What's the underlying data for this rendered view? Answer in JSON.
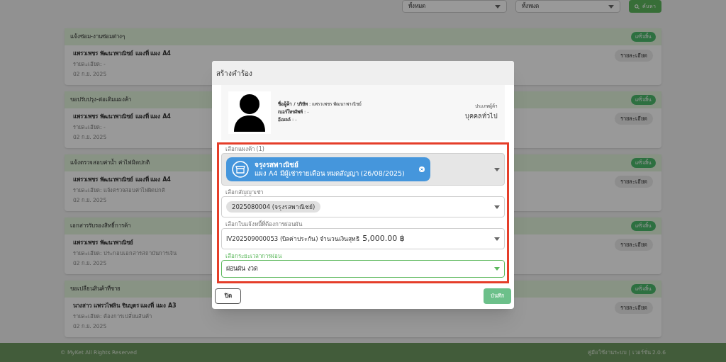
{
  "filters": [
    {
      "value": "ทั้งหมด"
    },
    {
      "value": "ทั้งหมด"
    }
  ],
  "search_button": "ค้นหา",
  "requests": [
    {
      "title": "แจ้งซ่อม-งานซ่อมต่างๆ",
      "status": "เสร็จสิ้น",
      "name": "แพรวเพชร พัฒนาพาณิชย์ แผงที่ แผง A4",
      "detail": "รายละเอียด: -",
      "date": "02 ก.ย. 2025",
      "action": "รายละเอียด"
    },
    {
      "title": "ขอปรับปรุง-ต่อเติมแผงค้า",
      "status": "เสร็จสิ้น",
      "name": "แพรวเพชร พัฒนาพาณิชย์ แผงที่ แผง A4",
      "detail": "รายละเอียด: -",
      "date": "02 ก.ย. 2025",
      "action": "รายละเอียด"
    },
    {
      "title": "แจ้งตรวจสอบค่าน้ำ ค่าไฟผิดปกติ",
      "status": "เสร็จสิ้น",
      "name": "แพรวเพชร พัฒนาพาณิชย์ แผงที่ แผง A4",
      "detail": "รายละเอียด: แจ้งตรวจสอบค่าไฟผิดปกติ",
      "date": "02 ก.ย. 2025",
      "action": "รายละเอียด"
    },
    {
      "title": "เอกสารรับรองสิทธิ์การค้า",
      "status": "เสร็จสิ้น",
      "name": "แพรวเพชร พัฒนาพาณิชย์",
      "detail": "รายละเอียด: ประกอบเอกสารสถาบันการเงิน",
      "date": "02 ก.ย. 2025",
      "action": "รายละเอียด"
    },
    {
      "title": "ขอเปลี่ยนสินค้าที่ขาย",
      "status": "เสร็จสิ้น",
      "name": "นางสาว แพรวไพลิน ชินบุตร แผงที่ แผง A3",
      "detail": "รายละเอียด: ต้องการเปลี่ยนสินค้า",
      "date": "02 ก.ย. 2025",
      "action": "รายละเอียด"
    }
  ],
  "footer": {
    "copyright": "© MyKet All Rights Reserved",
    "links": "คู่มือใช้งานระบบ | เวอร์ชั่น 2.0.6"
  },
  "modal": {
    "title": "สร้างคำร้อง",
    "customer": {
      "lines": [
        "**ชื่อผู้ค้า / บริษัท** : แพรวเพชร พัฒนาพาณิชย์",
        "**เบอร์โทรศัพท์** : -",
        "**อีเมลล์** : -"
      ],
      "type_label": "ประเภทผู้ค้า",
      "type": "บุคคลทั่วไป"
    },
    "fields": [
      {
        "kind": "shop",
        "label": "เลือกแผงค้า (1)",
        "chip_title": "จรุงรสพาณิชย์",
        "chip_subtitle": "แผง A4 มีผู้เช่ารายเดือน หมดสัญญา (26/08/2025)",
        "focused": false
      },
      {
        "kind": "chip",
        "label": "เลือกสัญญาเช่า",
        "value": "2025080004 (จรุงรสพาณิชย์)",
        "focused": false
      },
      {
        "kind": "invoice",
        "label": "เลือกใบแจ้งหนี้ที่ต้องการผ่อนผัน",
        "value": "IV202509000053 (บิลค่าประกัน) จำนวนเงินสุทธิ",
        "amount": "5,000.00 ฿",
        "focused": false
      },
      {
        "kind": "text",
        "label": "เลือกระยะเวลาการผ่อน",
        "value": "ผ่อนผัน งวด",
        "focused": true
      }
    ],
    "close_button": "ปิด",
    "save_button": "บันทึก"
  }
}
